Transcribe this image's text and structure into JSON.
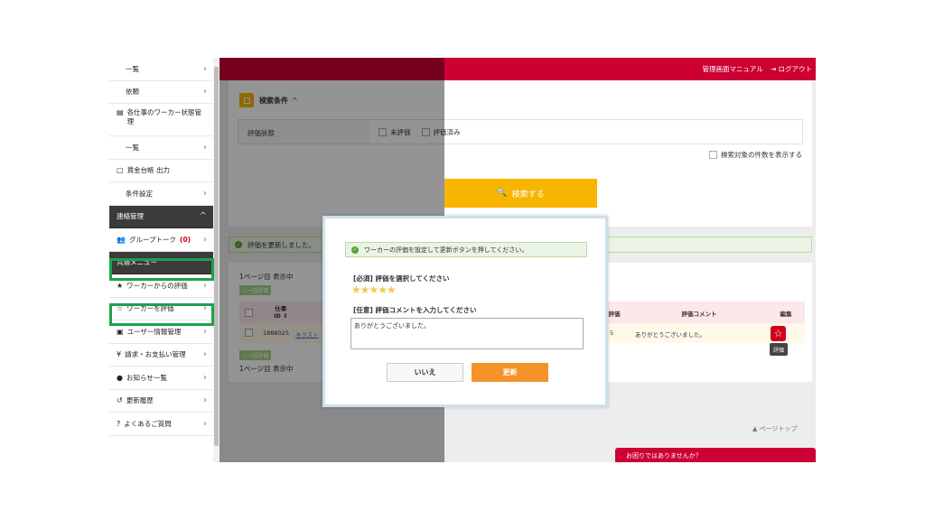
{
  "sidebar": {
    "items": [
      {
        "label": "一覧"
      },
      {
        "label": "依頼"
      },
      {
        "label": "各仕事のワーカー状態管理"
      },
      {
        "label": "一覧"
      },
      {
        "label": "賃金台帳 出力"
      },
      {
        "label": "条件設定"
      },
      {
        "label": "連絡管理"
      },
      {
        "label": "グループトーク",
        "count": "(0)"
      },
      {
        "label": "共通メニュー"
      },
      {
        "label": "ワーカーからの評価"
      },
      {
        "label": "ワーカーを評価"
      },
      {
        "label": "ユーザー情報管理"
      },
      {
        "label": "請求・お支払い管理"
      },
      {
        "label": "お知らせ一覧"
      },
      {
        "label": "更新履歴"
      },
      {
        "label": "よくあるご質問"
      }
    ]
  },
  "header": {
    "manual_link": "管理画面マニュアル",
    "logout_link": "ログアウト"
  },
  "search": {
    "title": "検索条件",
    "status_label": "評価状態",
    "opt_unrated": "未評価",
    "opt_rated": "評価済み",
    "count_toggle": "検索対象の件数を表示する",
    "button": "検索する"
  },
  "alert": {
    "updated": "評価を更新しました。"
  },
  "results": {
    "page_info_top": "1ページ目 表示中",
    "page_info_bottom": "1ページ目 表示中",
    "bulk_label": "一括評価",
    "col_job": "仕事",
    "col_id": "ID",
    "col_rate": "評価",
    "col_comment": "評価コメント",
    "col_edit": "編集",
    "row_id": "1888025",
    "row_link": "ネクスト",
    "row_rate_tail": "5",
    "row_comment": "ありがとうございました。",
    "edit_tooltip": "評価"
  },
  "footer": {
    "page_top": "ページトップ",
    "help": "お困りではありませんか？"
  },
  "modal": {
    "notice": "ワーカーの評価を設定して更新ボタンを押してください。",
    "required_label": "[必須] 評価を選択してください",
    "stars": "★★★★★",
    "optional_label": "[任意] 評価コメントを入力してください",
    "comment_value": "ありがとうございました。",
    "cancel": "いいえ",
    "submit": "更新"
  },
  "colors": {
    "brand_red": "#cc0033",
    "accent_yellow": "#f7b500",
    "update_orange": "#f5922b",
    "highlight_green": "#1aa34a"
  }
}
